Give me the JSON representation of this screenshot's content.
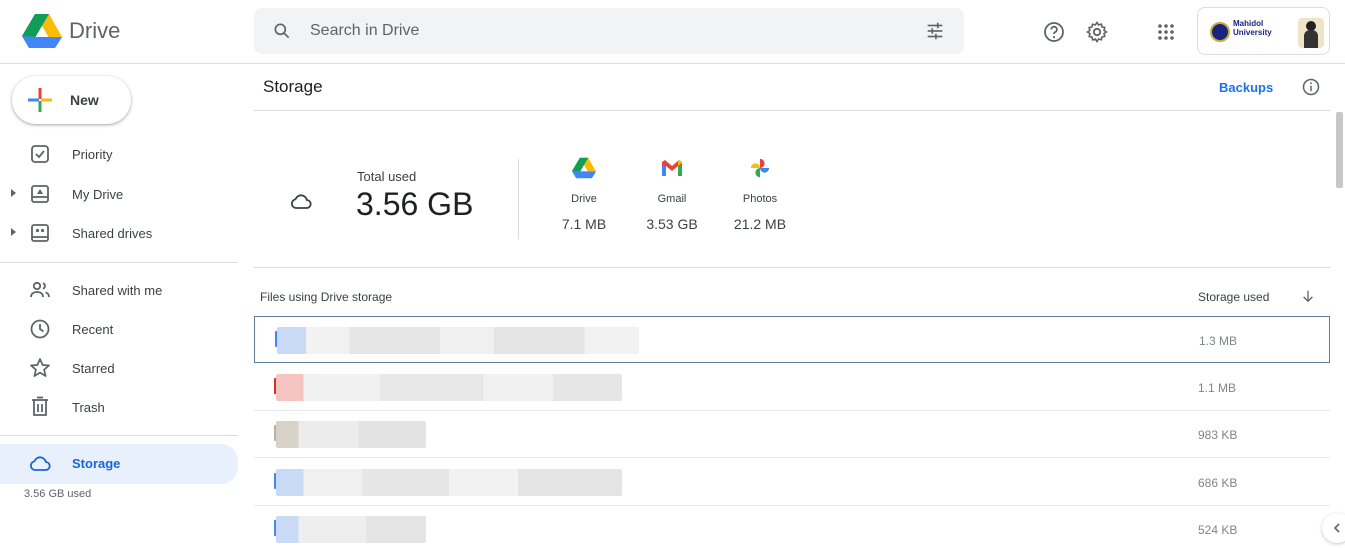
{
  "header": {
    "brand": "Drive",
    "search_placeholder": "Search in Drive",
    "account_name_line1": "Mahidol",
    "account_name_line2": "University"
  },
  "sidebar": {
    "new_label": "New",
    "items": [
      {
        "label": "Priority",
        "icon": "priority-icon"
      },
      {
        "label": "My Drive",
        "icon": "my-drive-icon"
      },
      {
        "label": "Shared drives",
        "icon": "shared-drives-icon"
      },
      {
        "label": "Shared with me",
        "icon": "shared-with-me-icon"
      },
      {
        "label": "Recent",
        "icon": "recent-icon"
      },
      {
        "label": "Starred",
        "icon": "star-icon"
      },
      {
        "label": "Trash",
        "icon": "trash-icon"
      },
      {
        "label": "Storage",
        "icon": "cloud-icon"
      }
    ],
    "storage_used": "3.56 GB used"
  },
  "main": {
    "title": "Storage",
    "backups_label": "Backups",
    "total_label": "Total used",
    "total_value": "3.56 GB",
    "services": [
      {
        "name": "Drive",
        "value": "7.1 MB"
      },
      {
        "name": "Gmail",
        "value": "3.53 GB"
      },
      {
        "name": "Photos",
        "value": "21.2 MB"
      }
    ],
    "list_header": "Files using Drive storage",
    "sort_header": "Storage used",
    "files": [
      {
        "size": "1.3 MB",
        "icon_color": "#4285f4"
      },
      {
        "size": "1.1 MB",
        "icon_color": "#d93025"
      },
      {
        "size": "983 KB",
        "icon_color": "#b8b0a0"
      },
      {
        "size": "686 KB",
        "icon_color": "#4285f4"
      },
      {
        "size": "524 KB",
        "icon_color": "#4285f4"
      }
    ]
  },
  "colors": {
    "accent": "#1a73e8",
    "active_bg": "#e8f0fe",
    "border": "#dadce0"
  }
}
